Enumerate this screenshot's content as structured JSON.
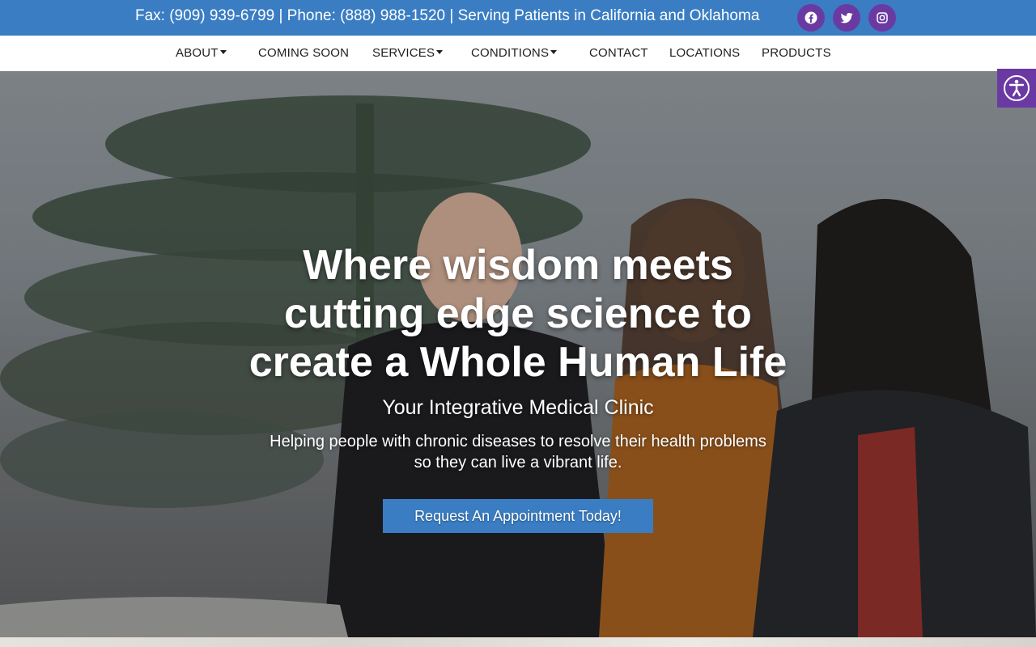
{
  "topbar": {
    "contact_text": "Fax: (909) 939-6799 | Phone: (888) 988-1520 | Serving Patients in California and Oklahoma",
    "social": [
      "facebook-icon",
      "twitter-icon",
      "instagram-icon"
    ],
    "color": "#3a7dc3",
    "social_color": "#6a3aa2"
  },
  "nav": {
    "items": [
      {
        "label": "ABOUT",
        "dropdown": true
      },
      {
        "label": "COMING SOON",
        "dropdown": false
      },
      {
        "label": "SERVICES",
        "dropdown": true
      },
      {
        "label": "CONDITIONS",
        "dropdown": true
      },
      {
        "label": "CONTACT",
        "dropdown": false
      },
      {
        "label": "LOCATIONS",
        "dropdown": false
      },
      {
        "label": "PRODUCTS",
        "dropdown": false
      }
    ]
  },
  "hero": {
    "headline_lines": [
      "Where wisdom meets",
      "cutting edge science to",
      "create a Whole Human Life"
    ],
    "subheading": "Your Integrative Medical Clinic",
    "description_lines": [
      "Helping people with chronic diseases to resolve their health problems",
      "so they can live a vibrant life."
    ],
    "cta_label": "Request An Appointment Today!"
  },
  "accessibility": {
    "icon": "accessibility-icon"
  }
}
